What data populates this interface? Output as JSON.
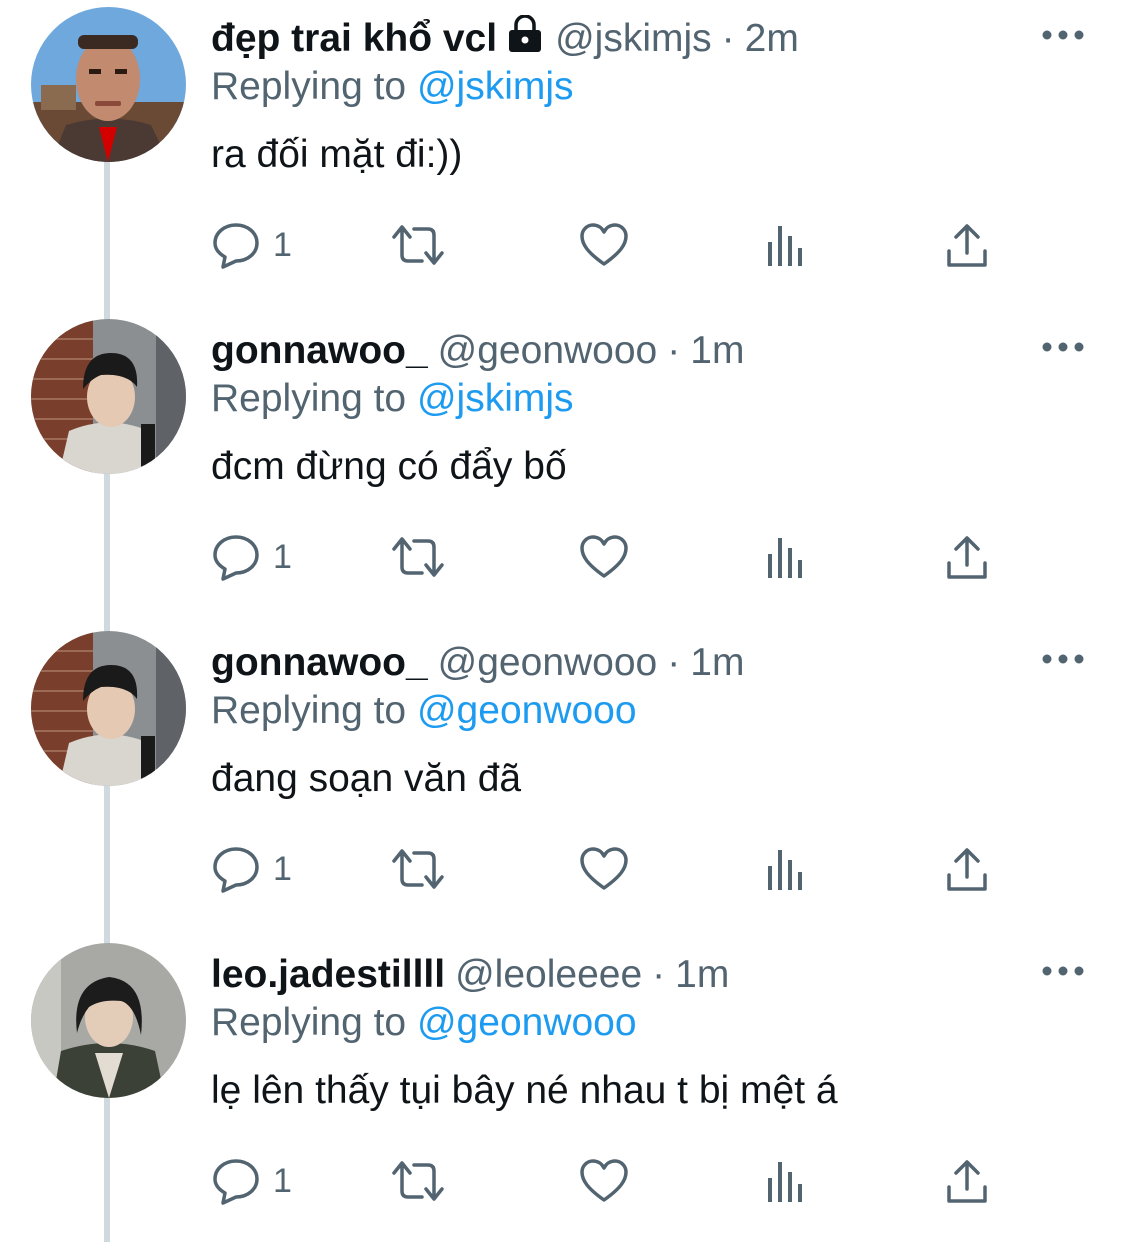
{
  "colors": {
    "accent": "#1d9bf0",
    "secondary_text": "#536471",
    "thread_line": "#cfd9de"
  },
  "tweets": [
    {
      "display_name": "đẹp trai khổ vcl",
      "protected_icon": "lock-icon",
      "handle": "@jskimjs",
      "dot": "·",
      "time": "2m",
      "replying_prefix": "Replying to",
      "replying_to": "@jskimjs",
      "text": "ra đối mặt đi:))",
      "reply_count": "1"
    },
    {
      "display_name": "gonnawoo_",
      "handle": "@geonwooo",
      "dot": "·",
      "time": "1m",
      "replying_prefix": "Replying to",
      "replying_to": "@jskimjs",
      "text": "đcm đừng có đẩy bố",
      "reply_count": "1"
    },
    {
      "display_name": "gonnawoo_",
      "handle": "@geonwooo",
      "dot": "·",
      "time": "1m",
      "replying_prefix": "Replying to",
      "replying_to": "@geonwooo",
      "text": "đang soạn văn đã",
      "reply_count": "1"
    },
    {
      "display_name": "leo.jadestillll",
      "handle": "@leoleeee",
      "dot": "·",
      "time": "1m",
      "replying_prefix": "Replying to",
      "replying_to": "@geonwooo",
      "text": "lẹ lên thấy tụi bây né nhau t bị mệt á",
      "reply_count": "1"
    }
  ],
  "action_icons": [
    "reply-icon",
    "retweet-icon",
    "like-icon",
    "analytics-icon",
    "share-icon"
  ]
}
